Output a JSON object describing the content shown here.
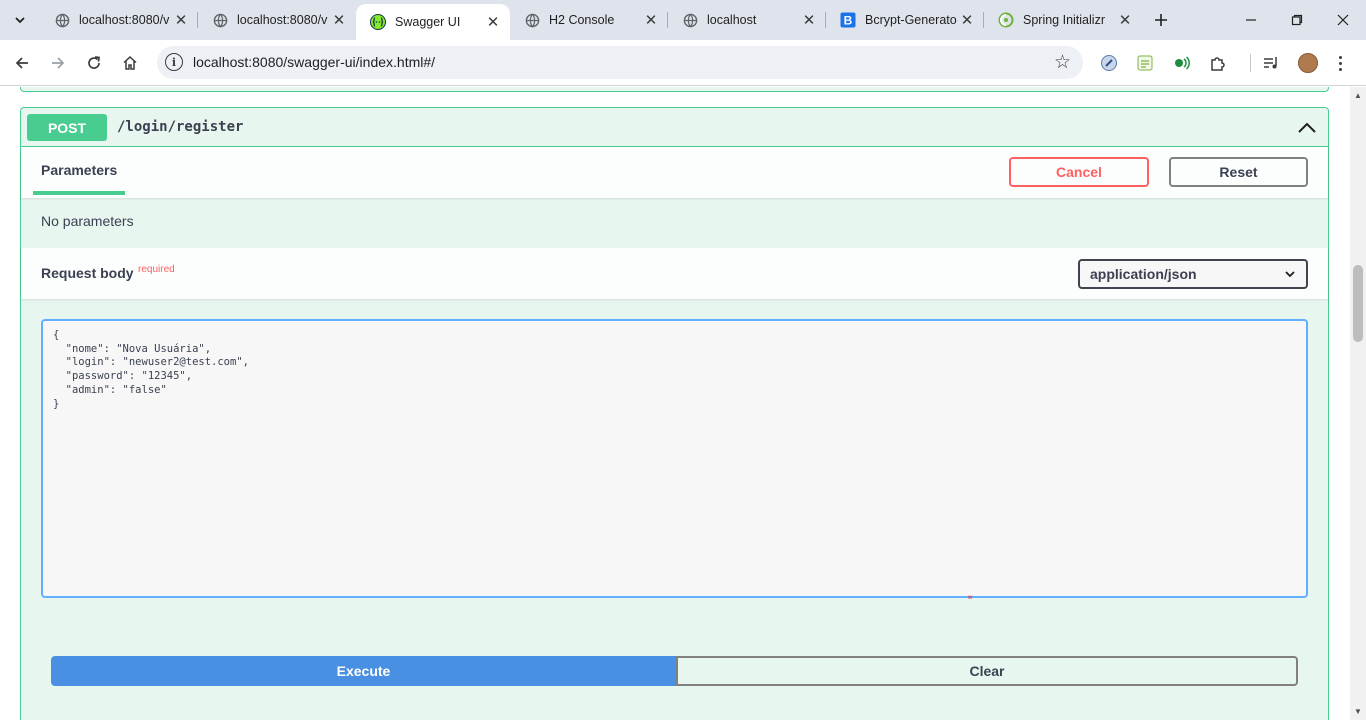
{
  "browser": {
    "tabs": [
      {
        "title": "localhost:8080/v",
        "favicon": "globe-icon"
      },
      {
        "title": "localhost:8080/v",
        "favicon": "globe-icon"
      },
      {
        "title": "Swagger UI",
        "favicon": "swagger-icon"
      },
      {
        "title": "H2 Console",
        "favicon": "globe-icon"
      },
      {
        "title": "localhost",
        "favicon": "globe-icon"
      },
      {
        "title": "Bcrypt-Generato",
        "favicon": "bcrypt-b-icon"
      },
      {
        "title": "Spring Initializr",
        "favicon": "spring-icon"
      }
    ],
    "active_tab_index": 2,
    "url": "localhost:8080/swagger-ui/index.html#/"
  },
  "operation": {
    "method": "POST",
    "path": "/login/register",
    "method_color": "#49cc90",
    "parameters_tab": "Parameters",
    "cancel_label": "Cancel",
    "reset_label": "Reset",
    "no_parameters": "No parameters",
    "request_body_title": "Request body",
    "required_label": "required",
    "content_type": "application/json",
    "body": "{\n  \"nome\": \"Nova Usuária\",\n  \"login\": \"newuser2@test.com\",\n  \"password\": \"12345\",\n  \"admin\": \"false\"\n}",
    "execute_label": "Execute",
    "clear_label": "Clear",
    "execute_color": "#4990e2",
    "cancel_color": "#ff6060"
  }
}
